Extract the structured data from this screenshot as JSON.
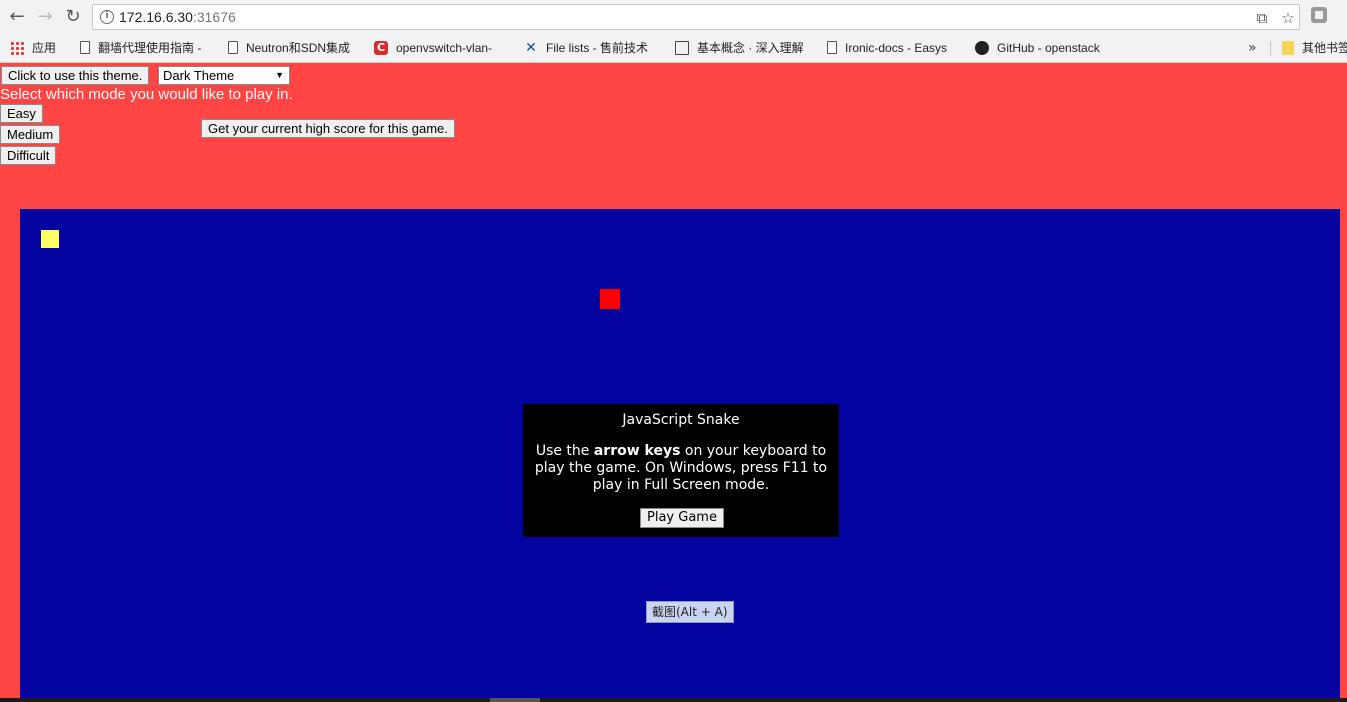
{
  "browser": {
    "url_host": "172.16.6.30",
    "url_port": ":31676",
    "bookmarks": [
      {
        "icon": "apps-icon",
        "label": "应用"
      },
      {
        "icon": "page-icon",
        "label": "翻墙代理使用指南 -"
      },
      {
        "icon": "page-icon",
        "label": "Neutron和SDN集成"
      },
      {
        "icon": "csdn-icon",
        "label": "openvswitch-vlan-"
      },
      {
        "icon": "tools-icon",
        "label": "File lists - 售前技术"
      },
      {
        "icon": "book-icon",
        "label": "基本概念 · 深入理解"
      },
      {
        "icon": "page-icon",
        "label": "Ironic-docs - Easys"
      },
      {
        "icon": "github-icon",
        "label": "GitHub - openstack"
      },
      {
        "icon": "folder-icon",
        "label": "其他书签"
      }
    ],
    "more_label": "»"
  },
  "controls": {
    "theme_button": "Click to use this theme.",
    "theme_select": "Dark Theme",
    "mode_prompt": "Select which mode you would like to play in.",
    "easy": "Easy",
    "medium": "Medium",
    "difficult": "Difficult",
    "high_score_button": "Get your current high score for this game."
  },
  "game": {
    "dialog_title": "JavaScript Snake",
    "desc_prefix": "Use the ",
    "desc_bold": "arrow keys",
    "desc_suffix": " on your keyboard to play the game. On Windows, press F11 to play in Full Screen mode.",
    "play_button": "Play Game"
  },
  "overlay": {
    "screenshot_tip": "截图(Alt + A)"
  },
  "colors": {
    "page_bg": "#ff4444",
    "board_bg": "#0303a0",
    "snake": "#ffff66",
    "food": "#ff0000"
  }
}
